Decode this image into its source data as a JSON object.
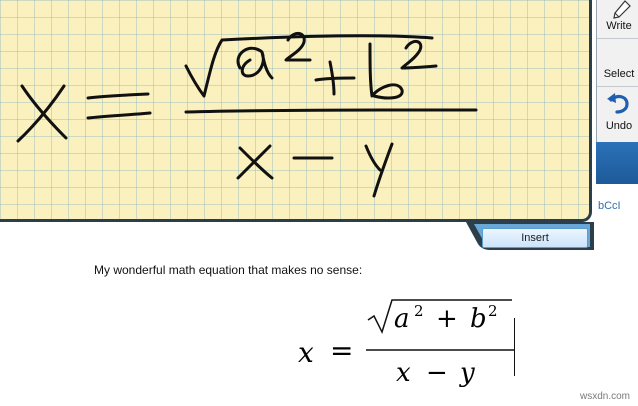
{
  "panel": {
    "insert_label": "Insert"
  },
  "toolbar": {
    "write_label": "Write",
    "select_label": "Select",
    "undo_label": "Undo",
    "colors": {
      "bar": "#1d5a99",
      "panel": "#fbf1bf"
    }
  },
  "document": {
    "fragment": "bCcI",
    "caption": "My wonderful math equation that makes no sense:",
    "formula": {
      "lhs": "x",
      "eq": "=",
      "a": "a",
      "a_exp": "2",
      "plus": "+",
      "b": "b",
      "b_exp": "2",
      "den_x": "x",
      "minus": "−",
      "den_y": "y"
    }
  },
  "watermark": "wsxdn.com"
}
